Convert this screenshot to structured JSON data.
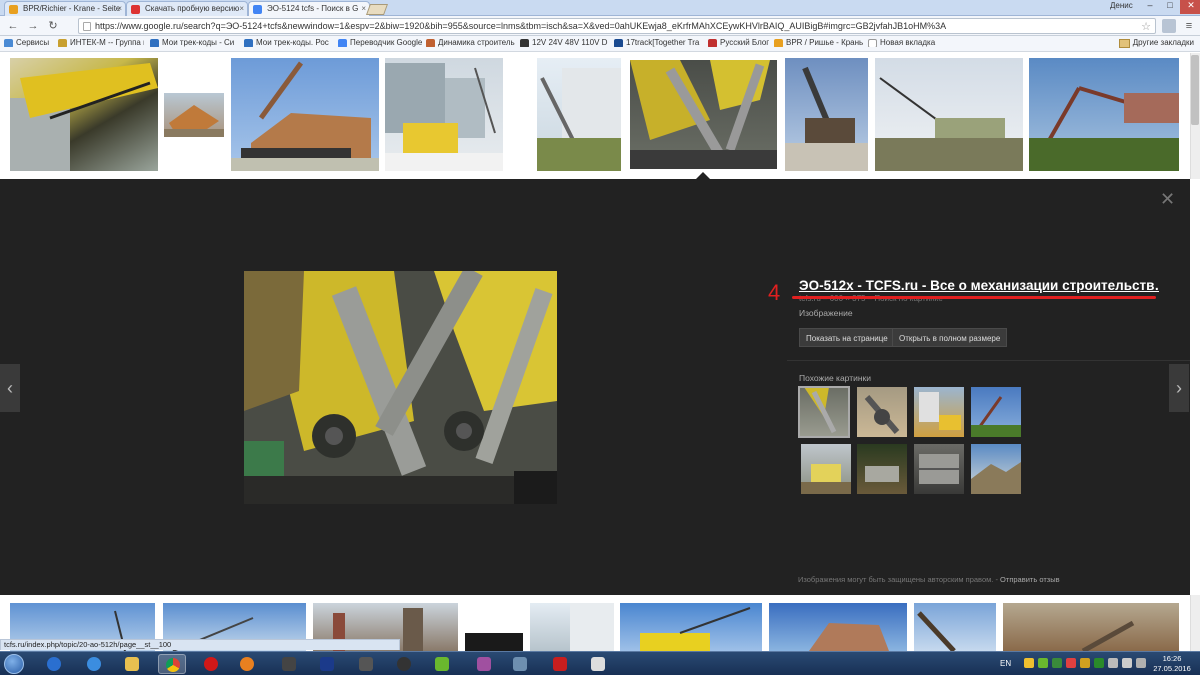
{
  "browser": {
    "tabs": [
      {
        "label": "BPR/Richier - Krane - Seite",
        "favicon_color": "#e8a020",
        "active": false
      },
      {
        "label": "Скачать пробную версию",
        "favicon_color": "#d33",
        "active": false
      },
      {
        "label": "ЭО-5124 tcfs - Поиск в G",
        "favicon_color": "#4285f4",
        "active": true
      }
    ],
    "user": "Денис",
    "window_controls": {
      "minimize": "–",
      "maximize": "□",
      "close": "✕"
    },
    "url": "https://www.google.ru/search?q=ЭО-5124+tcfs&newwindow=1&espv=2&biw=1920&bih=955&source=lnms&tbm=isch&sa=X&ved=0ahUKEwja8_eKrfrMAhXCEywKHVlrBAIQ_AUIBigB#imgrc=GB2jvfahJB1oHM%3A",
    "nav_icons": [
      "back-icon",
      "forward-icon",
      "reload-icon"
    ],
    "bookmarks": [
      {
        "label": "Сервисы",
        "color": "#4a8ad4"
      },
      {
        "label": "ИНТЕК-М -- Группа к",
        "color": "#c8a030"
      },
      {
        "label": "Мои трек-коды - Си",
        "color": "#3070c0"
      },
      {
        "label": "Мои трек-коды. Рос",
        "color": "#3070c0"
      },
      {
        "label": "Переводчик Google",
        "color": "#4285f4"
      },
      {
        "label": "Динамика строитель",
        "color": "#c06030"
      },
      {
        "label": "12V 24V 48V 110V DC",
        "color": "#333"
      },
      {
        "label": "17track[Together Tra",
        "color": "#1a4a90"
      },
      {
        "label": "Русский Блог",
        "color": "#c03030"
      },
      {
        "label": "BPR / Ришье - Крань",
        "color": "#e8a020"
      },
      {
        "label": "Новая вкладка",
        "color": "#ffffff"
      }
    ],
    "other_bookmarks": "Другие закладки"
  },
  "preview": {
    "number_annotation": "4",
    "title": "ЭО-512х - TCFS.ru - Все о механизации строительств…",
    "subtitle": "tcfs.ru – 600 × 375 – Поиск по картинке",
    "type": "Изображение",
    "visit_button": "Показать на странице",
    "view_full_button": "Открыть в полном размере",
    "similar_label": "Похожие картинки",
    "copyright": "Изображения могут быть защищены авторским правом.",
    "feedback_sep": " - ",
    "feedback_link": "Отправить отзыв",
    "prev_arrow": "‹",
    "next_arrow": "›",
    "close": "✕"
  },
  "status_url": "tcfs.ru/index.php/topic/20-ao-512h/page__st__100",
  "taskbar": {
    "apps": [
      {
        "name": "taskbar-flash-icon",
        "color": "#2a6fd0"
      },
      {
        "name": "taskbar-ie-icon",
        "color": "#3b8de0"
      },
      {
        "name": "taskbar-explorer-icon",
        "color": "#e8c050"
      },
      {
        "name": "taskbar-chrome-icon",
        "color": "#e0b020",
        "active": true
      },
      {
        "name": "taskbar-opera-icon",
        "color": "#d01818"
      },
      {
        "name": "taskbar-media-player-icon",
        "color": "#e88020"
      },
      {
        "name": "taskbar-inkscape-icon",
        "color": "#444"
      },
      {
        "name": "taskbar-photoshop-icon",
        "color": "#1b3a8a"
      },
      {
        "name": "taskbar-zbrush-icon",
        "color": "#555"
      },
      {
        "name": "taskbar-record-icon",
        "color": "#333"
      },
      {
        "name": "taskbar-utorrent-icon",
        "color": "#6ab82e"
      },
      {
        "name": "taskbar-winrar-icon",
        "color": "#a050a0"
      },
      {
        "name": "taskbar-calculator-icon",
        "color": "#6e8fb0"
      },
      {
        "name": "taskbar-acrobat-icon",
        "color": "#c81e1e"
      },
      {
        "name": "taskbar-table-icon",
        "color": "#ddd"
      }
    ],
    "lang": "EN",
    "time": "16:26",
    "date": "27.05.2016"
  }
}
